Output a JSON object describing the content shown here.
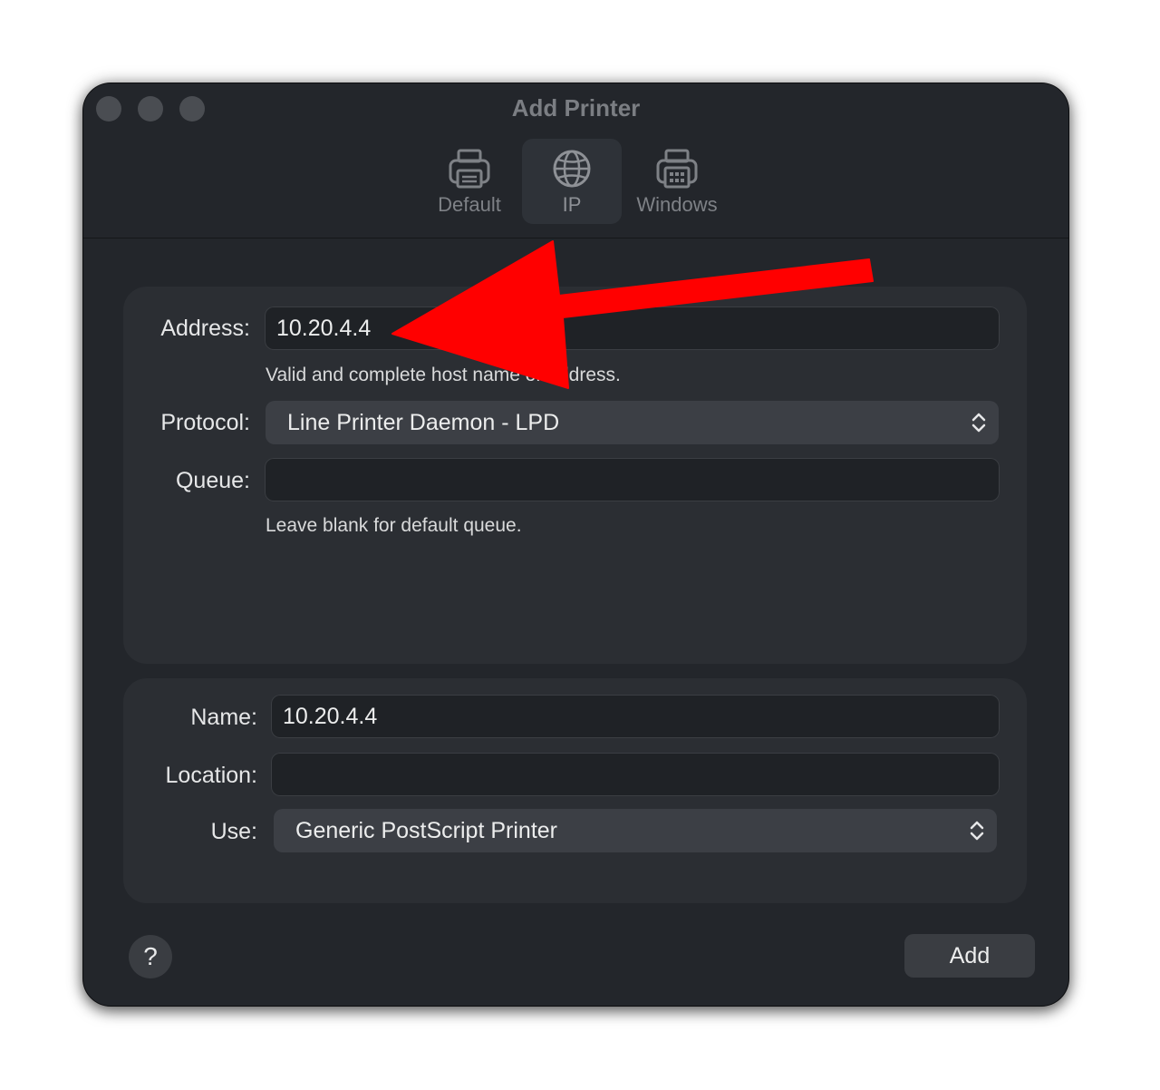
{
  "window": {
    "title": "Add Printer"
  },
  "toolbar": {
    "tabs": [
      {
        "label": "Default",
        "icon": "printer-icon",
        "selected": false
      },
      {
        "label": "IP",
        "icon": "globe-icon",
        "selected": true
      },
      {
        "label": "Windows",
        "icon": "windows-printer-icon",
        "selected": false
      }
    ]
  },
  "connection": {
    "address_label": "Address:",
    "address_value": "10.20.4.4",
    "address_hint": "Valid and complete host name or address.",
    "protocol_label": "Protocol:",
    "protocol_value": "Line Printer Daemon - LPD",
    "queue_label": "Queue:",
    "queue_value": "",
    "queue_hint": "Leave blank for default queue."
  },
  "printer": {
    "name_label": "Name:",
    "name_value": "10.20.4.4",
    "location_label": "Location:",
    "location_value": "",
    "use_label": "Use:",
    "use_value": "Generic PostScript Printer"
  },
  "footer": {
    "help_label": "?",
    "add_label": "Add"
  },
  "annotation": {
    "arrow_color": "#ff0000",
    "points_to": "address-field"
  },
  "colors": {
    "window_bg": "#23262b",
    "panel_bg": "#2b2e33",
    "field_bg": "#1f2226",
    "popup_bg": "#3c3f45"
  }
}
